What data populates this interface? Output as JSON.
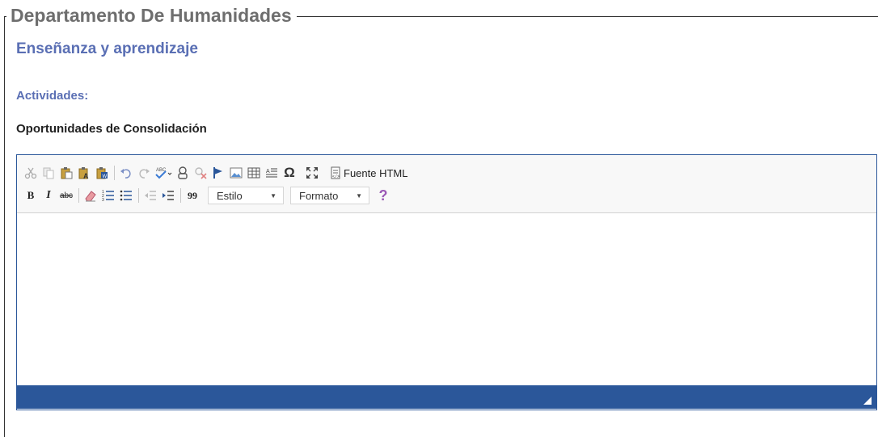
{
  "fieldset": {
    "legend": "Departamento De Humanidades"
  },
  "subtitle": "Enseñanza y aprendizaje",
  "activities_label": "Actividades:",
  "section_title": "Oportunidades de Consolidación",
  "editor": {
    "toolbar_row1": [
      {
        "icon": "cut-icon",
        "title": "Cortar"
      },
      {
        "icon": "copy-icon",
        "title": "Copiar"
      },
      {
        "icon": "paste-icon",
        "title": "Pegar"
      },
      {
        "icon": "paste-text-icon",
        "title": "Pegar como texto"
      },
      {
        "icon": "paste-word-icon",
        "title": "Pegar desde Word"
      },
      {
        "icon": "undo-icon",
        "title": "Deshacer"
      },
      {
        "icon": "redo-icon",
        "title": "Rehacer"
      },
      {
        "icon": "spellcheck-icon",
        "title": "Ortografía"
      },
      {
        "icon": "link-icon",
        "title": "Vínculo"
      },
      {
        "icon": "unlink-icon",
        "title": "Eliminar vínculo"
      },
      {
        "icon": "anchor-icon",
        "title": "Ancla"
      },
      {
        "icon": "image-icon",
        "title": "Imagen"
      },
      {
        "icon": "table-icon",
        "title": "Tabla"
      },
      {
        "icon": "horizontal-rule-icon",
        "title": "Línea horizontal"
      },
      {
        "icon": "special-char-icon",
        "title": "Carácter especial"
      },
      {
        "icon": "maximize-icon",
        "title": "Maximizar"
      }
    ],
    "source_label": "Fuente HTML",
    "toolbar_row2": {
      "bold": "B",
      "italic": "I",
      "strike": "abc",
      "blockquote": "99",
      "style_label": "Estilo",
      "format_label": "Formato",
      "help": "?"
    },
    "colors": {
      "accent": "#2b579a",
      "heading": "#5a6fb4",
      "help": "#9b59b6"
    }
  }
}
